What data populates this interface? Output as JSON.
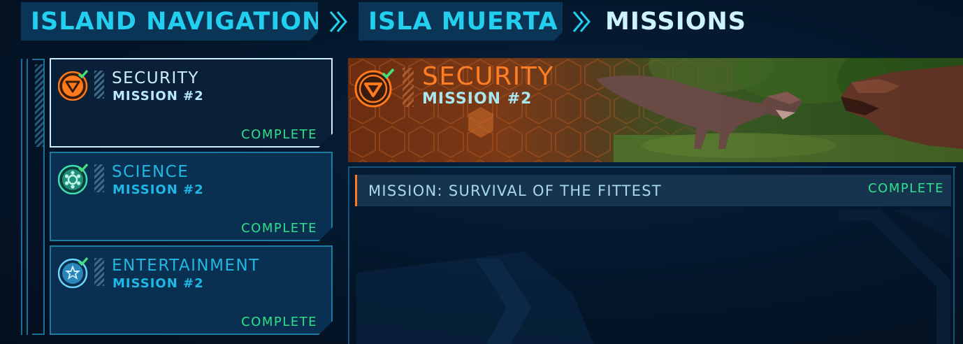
{
  "breadcrumb": {
    "items": [
      "ISLAND NAVIGATION",
      "ISLA MUERTA"
    ],
    "current": "MISSIONS"
  },
  "missions": [
    {
      "category": "SECURITY",
      "mission": "MISSION #2",
      "status": "COMPLETE",
      "icon": "security-icon",
      "color": "#ff7a1e",
      "selected": true
    },
    {
      "category": "SCIENCE",
      "mission": "MISSION #2",
      "status": "COMPLETE",
      "icon": "science-icon",
      "color": "#3fe0b0",
      "selected": false
    },
    {
      "category": "ENTERTAINMENT",
      "mission": "MISSION #2",
      "status": "COMPLETE",
      "icon": "entertainment-icon",
      "color": "#6fd2ff",
      "selected": false
    }
  ],
  "detail": {
    "category": "SECURITY",
    "mission": "MISSION #2",
    "objective": {
      "name": "MISSION: SURVIVAL OF THE FITTEST",
      "status": "COMPLETE"
    }
  },
  "colors": {
    "accent": "#23cfef",
    "security": "#ff7a1e",
    "complete": "#2ee08a",
    "check": "#44e07a"
  }
}
